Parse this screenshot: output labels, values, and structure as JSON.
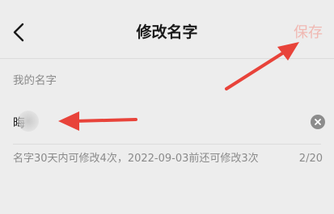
{
  "header": {
    "back_icon": "chevron-left-icon",
    "title": "修改名字",
    "save_label": "保存",
    "save_color": "#f0b8b2"
  },
  "form": {
    "section_label": "我的名字",
    "name_value": "晦",
    "clear_icon": "clear-circle-icon",
    "hint": "名字30天内可修改4次，2022-09-03前还可修改3次",
    "char_count": "2/20"
  },
  "annotations": {
    "arrow_color": "#e8433a"
  }
}
